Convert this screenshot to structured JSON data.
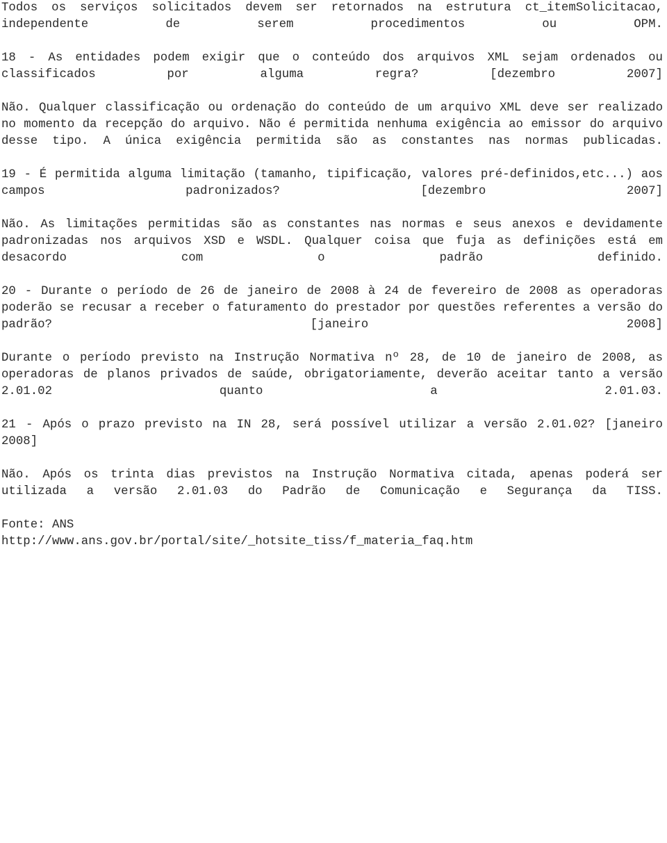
{
  "document": {
    "type": "faq-continuation-page",
    "language": "pt-BR",
    "background_color": "#ffffff",
    "text_color": "#2b2b2b",
    "blocks": [
      {
        "id": "intro-answer-continued",
        "role": "answer",
        "text": "Todos os serviços solicitados devem ser retornados na estrutura ct_itemSolicitacao, independente de serem procedimentos ou OPM."
      },
      {
        "id": "question-18",
        "role": "question",
        "number": "18",
        "text": "18 - As entidades podem exigir que o conteúdo dos arquivos XML sejam ordenados ou classificados por alguma regra? [dezembro 2007]",
        "date_tag": "[dezembro 2007]"
      },
      {
        "id": "answer-18",
        "role": "answer",
        "text": "Não. Qualquer classificação ou ordenação do conteúdo de um arquivo XML deve ser realizado no momento da recepção do arquivo. Não é permitida nenhuma exigência ao emissor do arquivo desse tipo. A única exigência permitida são as constantes nas normas publicadas."
      },
      {
        "id": "question-19",
        "role": "question",
        "number": "19",
        "text": "19 - É permitida alguma limitação (tamanho, tipificação, valores pré-definidos,etc...) aos campos padronizados? [dezembro 2007]",
        "date_tag": "[dezembro 2007]"
      },
      {
        "id": "answer-19",
        "role": "answer",
        "text": "Não. As limitações permitidas são as constantes nas normas e seus anexos e devidamente padronizadas nos arquivos XSD e WSDL. Qualquer coisa que fuja as definições está em desacordo com o padrão definido."
      },
      {
        "id": "question-20",
        "role": "question",
        "number": "20",
        "text": "20 - Durante o período de 26 de janeiro de 2008 à 24 de fevereiro de 2008 as operadoras poderão se recusar a receber o faturamento do prestador por questões referentes a versão do padrão? [janeiro 2008]",
        "date_tag": "[janeiro 2008]"
      },
      {
        "id": "answer-20",
        "role": "answer",
        "text": "Durante o período previsto na Instrução Normativa nº 28, de 10 de janeiro de 2008, as operadoras de planos privados de saúde, obrigatoriamente, deverão aceitar tanto a versão 2.01.02 quanto a 2.01.03."
      },
      {
        "id": "question-21",
        "role": "question",
        "number": "21",
        "text": "21 - Após o prazo previsto na IN 28, será possível utilizar a versão 2.01.02? [janeiro 2008]",
        "date_tag": "[janeiro 2008]"
      },
      {
        "id": "answer-21",
        "role": "answer",
        "text": "Não. Após os trinta dias previstos na Instrução Normativa citada, apenas poderá ser utilizada a versão 2.01.03 do Padrão de Comunicação e Segurança da TISS."
      },
      {
        "id": "source-label",
        "role": "source",
        "text": "Fonte: ANS"
      },
      {
        "id": "source-url",
        "role": "url",
        "text": "http://www.ans.gov.br/portal/site/_hotsite_tiss/f_materia_faq.htm"
      }
    ]
  }
}
